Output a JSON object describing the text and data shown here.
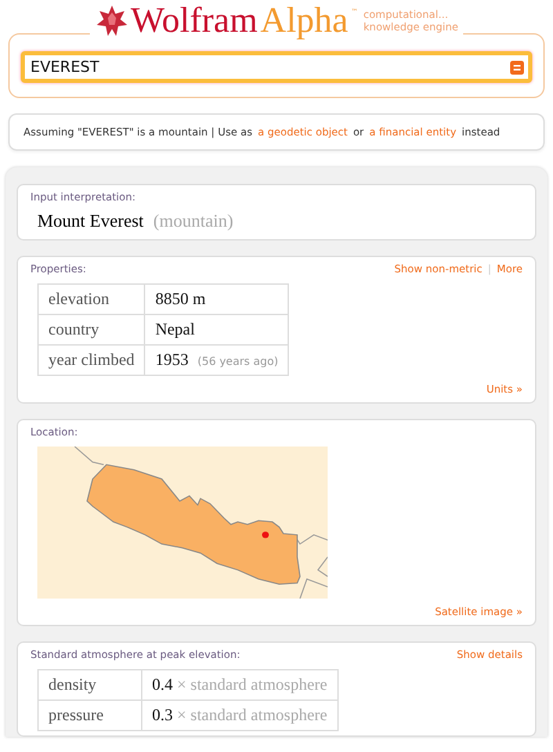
{
  "logo": {
    "word_1": "Wolfram",
    "word_2": "Alpha",
    "trademark": "™",
    "tagline_1": "computational...",
    "tagline_2": "knowledge engine"
  },
  "search": {
    "value": "EVEREST"
  },
  "assumption": {
    "text": "Assuming \"EVEREST\" is a mountain | Use as",
    "link_1": "a geodetic object",
    "joiner": "or",
    "link_2": "a financial entity",
    "tail": "instead"
  },
  "pods": [
    {
      "kind": "interpretation",
      "title": "Input interpretation:",
      "name": "Mount Everest",
      "type": "(mountain)"
    },
    {
      "kind": "table",
      "title": "Properties:",
      "actions": [
        "Show non-metric",
        "More"
      ],
      "separator": "|",
      "rows": [
        {
          "label": "elevation",
          "value": "8850 m"
        },
        {
          "label": "country",
          "value": "Nepal"
        },
        {
          "label": "year climbed",
          "value": "1953",
          "note": "(56 years ago)"
        }
      ],
      "footer": "Units »"
    },
    {
      "kind": "map",
      "title": "Location:",
      "footer": "Satellite image »"
    },
    {
      "kind": "table",
      "title": "Standard atmosphere at peak elevation:",
      "actions": [
        "Show details"
      ],
      "rows": [
        {
          "label": "density",
          "value": "0.4",
          "note": "× standard atmosphere"
        },
        {
          "label": "pressure",
          "value": "0.3",
          "note": "× standard atmosphere"
        }
      ]
    }
  ]
}
